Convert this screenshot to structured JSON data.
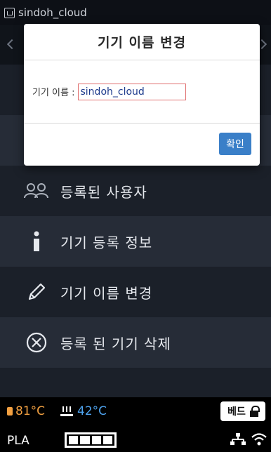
{
  "status_bar": {
    "device_name": "sindoh_cloud"
  },
  "dialog": {
    "title": "기기 이름 변경",
    "field_label": "기기 이름 :",
    "field_value": "sindoh_cloud",
    "confirm_label": "확인"
  },
  "menu": {
    "items": [
      {
        "label": "등록된 사용자",
        "icon": "users-icon"
      },
      {
        "label": "기기 등록 정보",
        "icon": "info-icon"
      },
      {
        "label": "기기 이름 변경",
        "icon": "pencil-icon"
      },
      {
        "label": "등록 된 기기 삭제",
        "icon": "close-circle-icon"
      }
    ]
  },
  "bottom_bar": {
    "nozzle_temp": "81°C",
    "bed_temp": "42°C",
    "material": "PLA",
    "filament_level": 1.0,
    "bed_button_label": "베드"
  },
  "colors": {
    "nozzle": "#f2a041",
    "bed": "#4ea3ee",
    "confirm_button": "#3a7fc8",
    "background": "#1b2029"
  }
}
